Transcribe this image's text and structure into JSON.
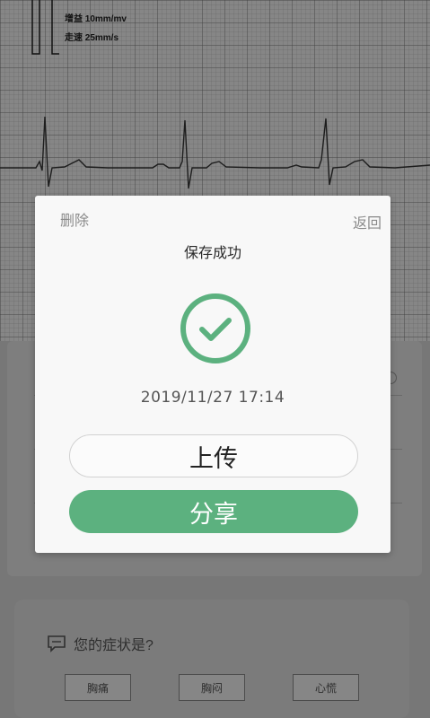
{
  "ecg": {
    "gain_label": "增益 10mm/mv",
    "speed_label": "走速 25mm/s"
  },
  "modal": {
    "delete_label": "删除",
    "back_label": "返回",
    "title": "保存成功",
    "timestamp": "2019/11/27 17:14",
    "upload_label": "上传",
    "share_label": "分享",
    "accent_color": "#5cb17f"
  },
  "symptoms": {
    "question": "您的症状是?",
    "chips": [
      "胸痛",
      "胸闷",
      "心慌"
    ]
  },
  "icons": [
    "chat-icon",
    "check-circle-icon"
  ]
}
